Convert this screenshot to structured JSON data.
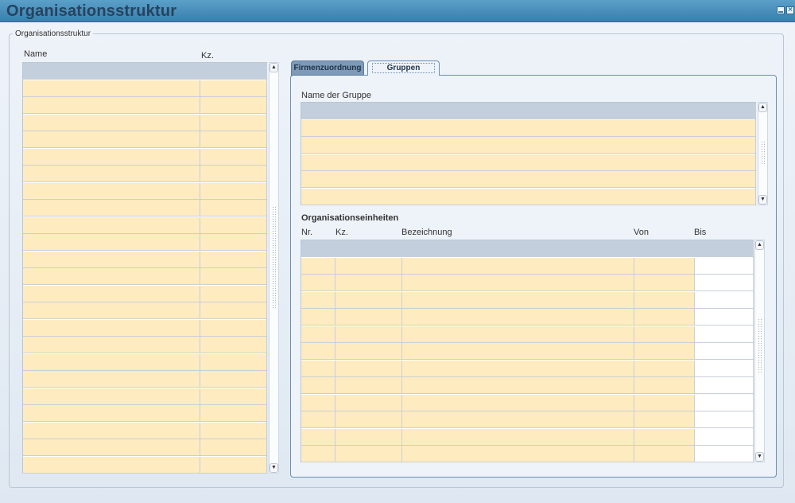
{
  "window": {
    "title": "Organisationsstruktur"
  },
  "group": {
    "label": "Organisationsstruktur"
  },
  "left_table": {
    "columns": [
      "Name",
      "Kz."
    ],
    "row_count": 23
  },
  "tabs": [
    {
      "label": "Firmenzuordnung",
      "active": false
    },
    {
      "label": "Gruppen",
      "active": true
    }
  ],
  "gruppen": {
    "label": "Name der Gruppe",
    "row_count": 5
  },
  "org_units": {
    "heading": "Organisationseinheiten",
    "columns": [
      "Nr.",
      "Kz.",
      "Bezeichnung",
      "Von",
      "Bis"
    ],
    "row_count": 12
  },
  "colors": {
    "header_cell": "#c3cfdc",
    "editable_cell": "#ffebc0",
    "title_text": "#26435e"
  }
}
